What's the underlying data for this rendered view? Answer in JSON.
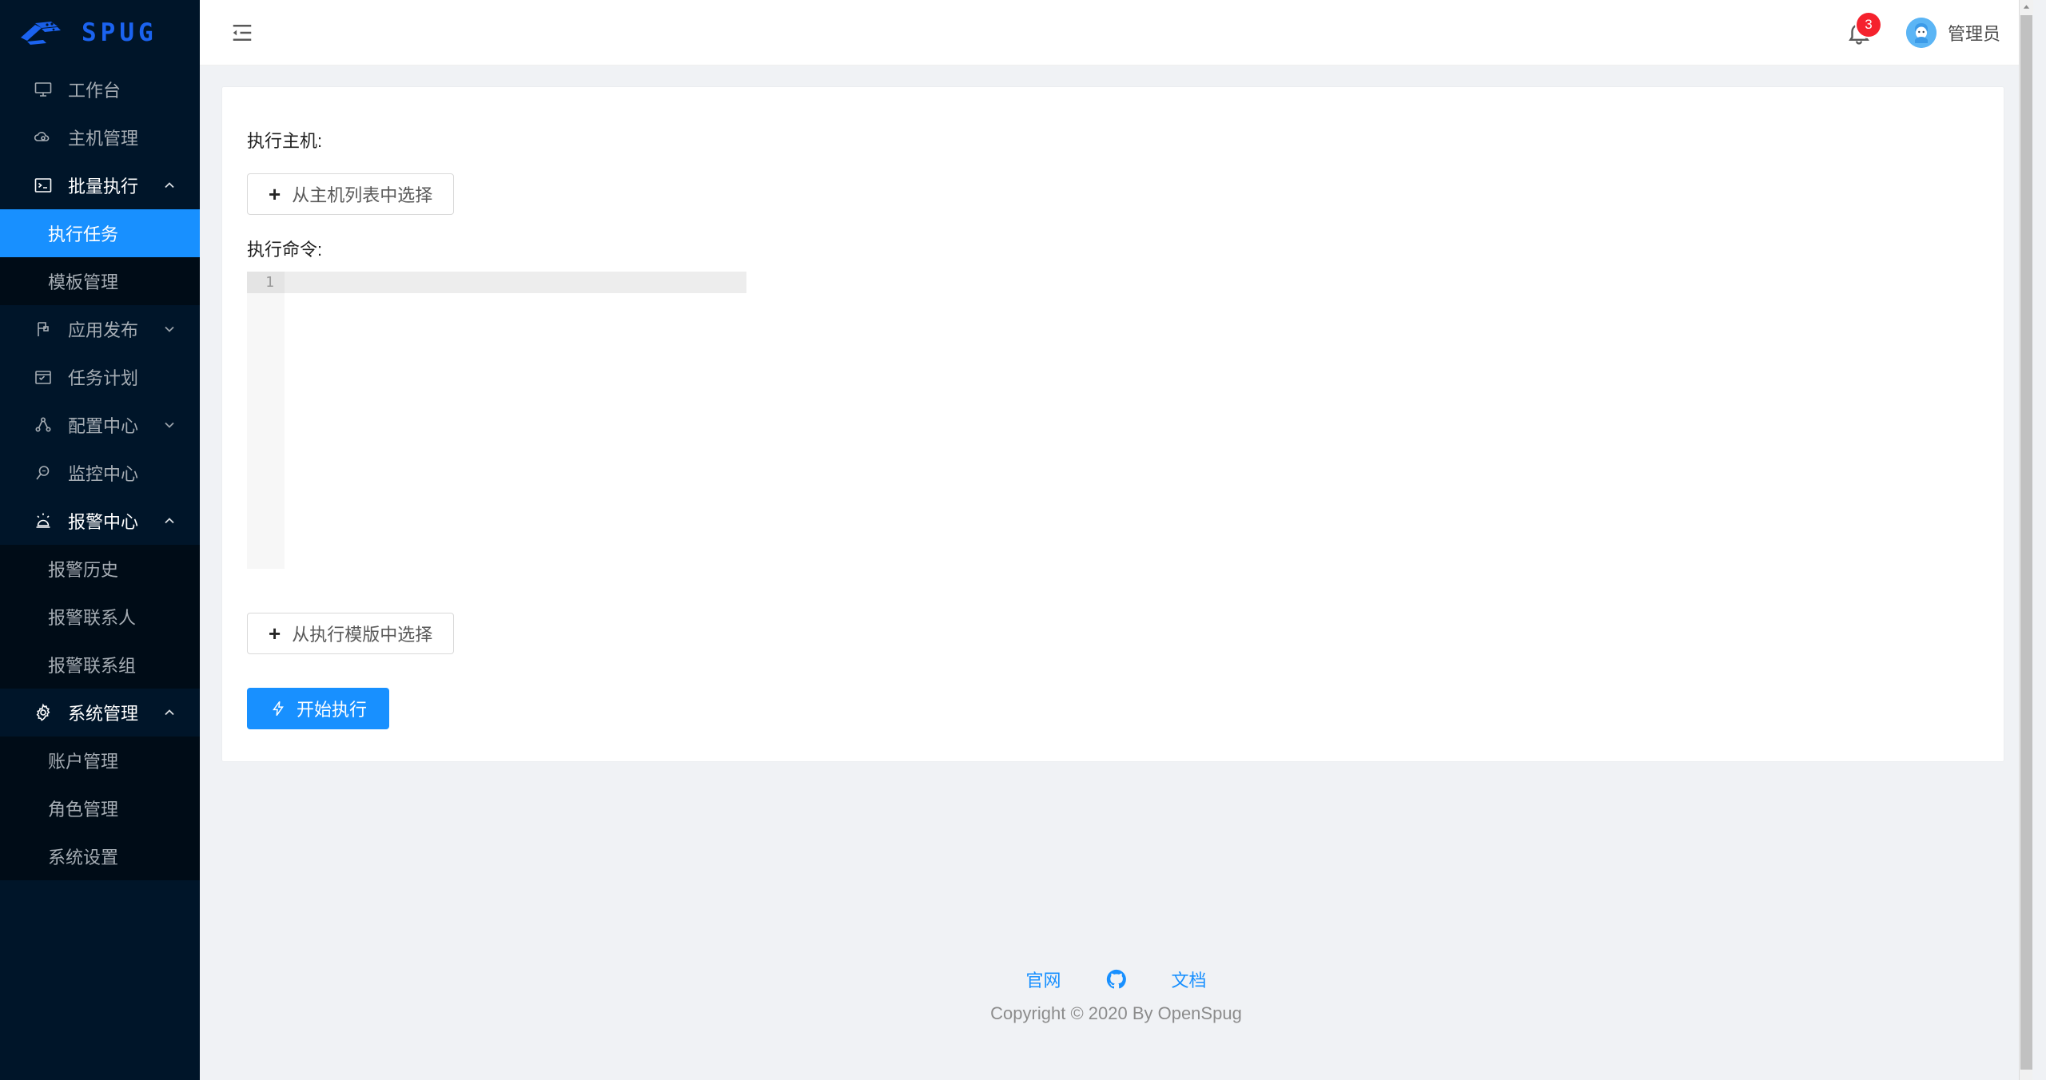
{
  "brand": {
    "name": "SPUG",
    "logo_icon": "spug-logo-icon"
  },
  "sidebar": {
    "items": [
      {
        "label": "工作台",
        "icon": "desktop-icon",
        "type": "item"
      },
      {
        "label": "主机管理",
        "icon": "cloud-server-icon",
        "type": "item"
      },
      {
        "label": "批量执行",
        "icon": "console-icon",
        "type": "group",
        "expanded": true,
        "children": [
          {
            "label": "执行任务",
            "active": true
          },
          {
            "label": "模板管理",
            "active": false
          }
        ]
      },
      {
        "label": "应用发布",
        "icon": "flag-icon",
        "type": "group",
        "expanded": false
      },
      {
        "label": "任务计划",
        "icon": "calendar-icon",
        "type": "item"
      },
      {
        "label": "配置中心",
        "icon": "cluster-icon",
        "type": "group",
        "expanded": false
      },
      {
        "label": "监控中心",
        "icon": "search-monitor-icon",
        "type": "item"
      },
      {
        "label": "报警中心",
        "icon": "alert-icon",
        "type": "group",
        "expanded": true,
        "children": [
          {
            "label": "报警历史",
            "active": false
          },
          {
            "label": "报警联系人",
            "active": false
          },
          {
            "label": "报警联系组",
            "active": false
          }
        ]
      },
      {
        "label": "系统管理",
        "icon": "gear-icon",
        "type": "group",
        "expanded": true,
        "children": [
          {
            "label": "账户管理",
            "active": false
          },
          {
            "label": "角色管理",
            "active": false
          },
          {
            "label": "系统设置",
            "active": false
          }
        ]
      }
    ]
  },
  "topbar": {
    "fold_icon": "menu-fold-icon",
    "bell_icon": "bell-icon",
    "notification_count": "3",
    "avatar_icon": "user-avatar-icon",
    "user_name": "管理员"
  },
  "main": {
    "host_label": "执行主机:",
    "select_host_button": "从主机列表中选择",
    "command_label": "执行命令:",
    "editor": {
      "line_numbers": [
        "1"
      ],
      "lines": [
        ""
      ]
    },
    "select_template_button": "从执行模版中选择",
    "run_button": "开始执行",
    "run_button_icon": "thunderbolt-icon",
    "plus_icon": "plus-icon"
  },
  "footer": {
    "links": [
      {
        "label": "官网",
        "icon": ""
      },
      {
        "label": "",
        "icon": "github-icon"
      },
      {
        "label": "文档",
        "icon": ""
      }
    ],
    "official_site": "官网",
    "docs": "文档",
    "github_icon": "github-icon",
    "copyright": "Copyright © 2020 By OpenSpug"
  },
  "colors": {
    "accent": "#1890ff",
    "sidebar_bg": "#001529",
    "submenu_bg": "#000c17",
    "badge": "#f5222d",
    "page_bg": "#f0f2f5"
  }
}
